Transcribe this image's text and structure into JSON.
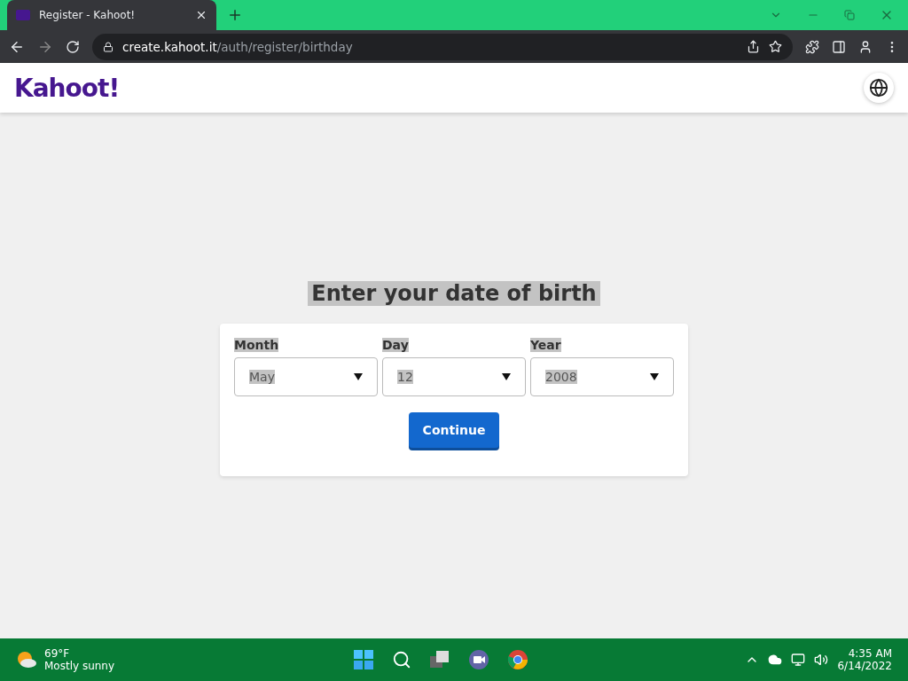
{
  "browser": {
    "tab_title": "Register - Kahoot!",
    "url_host": "create.kahoot.it",
    "url_path": "/auth/register/birthday"
  },
  "site": {
    "logo": "Kahoot!"
  },
  "form": {
    "heading": "Enter your date of birth",
    "fields": [
      {
        "label": "Month",
        "value": "May"
      },
      {
        "label": "Day",
        "value": "12"
      },
      {
        "label": "Year",
        "value": "2008"
      }
    ],
    "button": "Continue"
  },
  "taskbar": {
    "temperature": "69°F",
    "weather": "Mostly sunny",
    "time": "4:35 AM",
    "date": "6/14/2022"
  }
}
